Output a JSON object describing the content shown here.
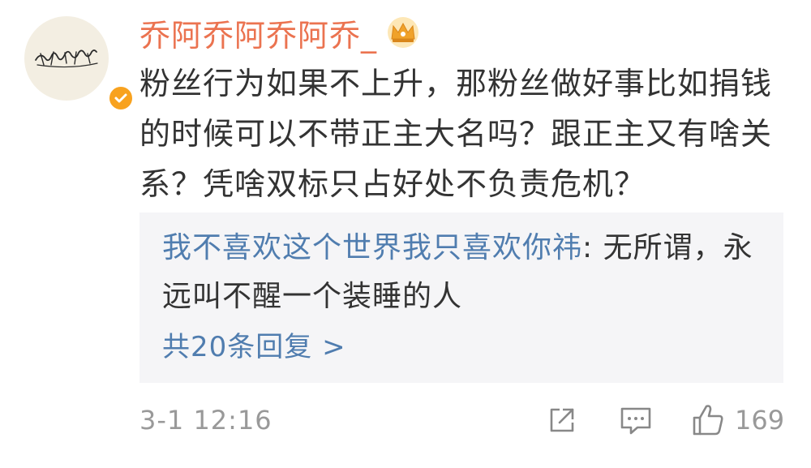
{
  "comment": {
    "username": "乔阿乔阿乔阿乔_",
    "avatar_signature": "乔阿乔阿乔阿乔",
    "text": "粉丝行为如果不上升，那粉丝做好事比如捐钱的时候可以不带正主大名吗？跟正主又有啥关系？凭啥双标只占好处不负责危机？",
    "timestamp": "3-1 12:16",
    "like_count": "169",
    "badges": {
      "verified_color": "#f8a21f",
      "crown_color": "#f0a22a",
      "username_color": "#eb7350"
    }
  },
  "reply": {
    "user": "我不喜欢这个世界我只喜欢你祎",
    "separator": ": ",
    "text": "无所谓，永远叫不醒一个装睡的人",
    "more_label": "共20条回复 >",
    "link_color": "#507daf"
  },
  "icons": [
    "verified-icon",
    "crown-icon",
    "share-icon",
    "comment-icon",
    "like-icon"
  ]
}
